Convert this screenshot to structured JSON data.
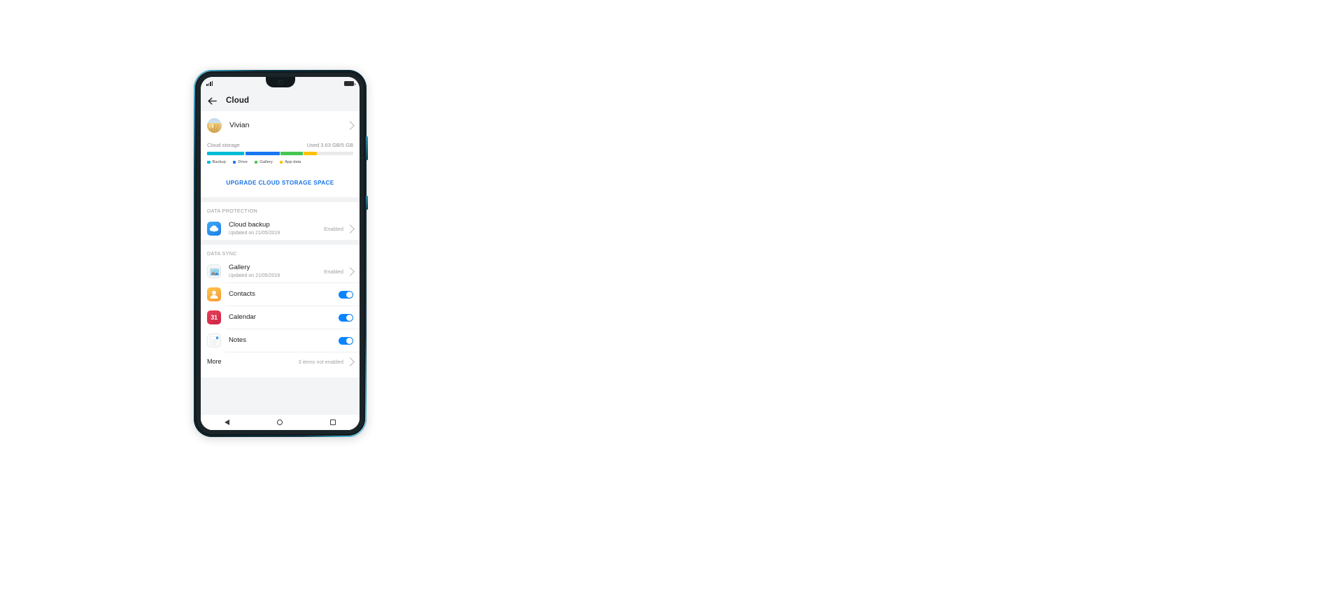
{
  "device": {
    "status_bar": {
      "signal_icon": "signal-bars-icon",
      "battery_icon": "battery-icon"
    },
    "nav_bar": {
      "back": "nav-back-triangle-icon",
      "home": "nav-home-circle-icon",
      "recents": "nav-recents-square-icon"
    }
  },
  "appbar": {
    "back_icon": "back-arrow-icon",
    "title": "Cloud"
  },
  "account": {
    "avatar_icon": "user-avatar",
    "name": "Vivian",
    "chevron_icon": "chevron-right-icon"
  },
  "storage": {
    "label": "Cloud storage",
    "used_text": "Used 3.63 GB/5 GB",
    "upgrade_label": "UPGRADE CLOUD STORAGE SPACE",
    "accent_color": "#1a73e8",
    "track_color": "#e8eaec",
    "segments": [
      {
        "name": "Backup",
        "color": "#00bcd4",
        "percent": 25.5
      },
      {
        "name": "Drive",
        "color": "#1877f2",
        "percent": 23.5
      },
      {
        "name": "Gallery",
        "color": "#45c654",
        "percent": 15.0
      },
      {
        "name": "App data",
        "color": "#ffc107",
        "percent": 9.0
      }
    ]
  },
  "sections": [
    {
      "title": "DATA PROTECTION",
      "rows": [
        {
          "icon": "cloud-backup-icon",
          "title": "Cloud backup",
          "subtitle": "Updated on 21/05/2019",
          "value": "Enabled",
          "control": "chevron"
        }
      ]
    },
    {
      "title": "DATA SYNC",
      "rows": [
        {
          "icon": "gallery-icon",
          "title": "Gallery",
          "subtitle": "Updated on 21/05/2019",
          "value": "Enabled",
          "control": "chevron"
        },
        {
          "icon": "contacts-icon",
          "title": "Contacts",
          "subtitle": "",
          "value": "",
          "control": "toggle",
          "toggle_on": true
        },
        {
          "icon": "calendar-icon",
          "title": "Calendar",
          "subtitle": "",
          "value": "",
          "control": "toggle",
          "toggle_on": true,
          "icon_text": "31"
        },
        {
          "icon": "notes-icon",
          "title": "Notes",
          "subtitle": "",
          "value": "",
          "control": "toggle",
          "toggle_on": true
        }
      ]
    }
  ],
  "more": {
    "label": "More",
    "value": "3 items not enabled",
    "chevron_icon": "chevron-right-icon"
  }
}
